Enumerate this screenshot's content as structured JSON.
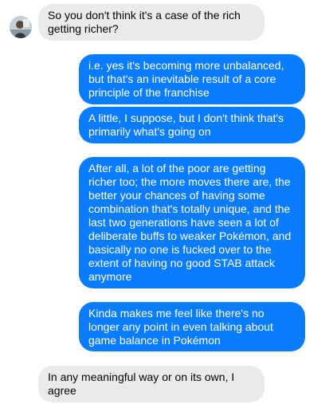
{
  "colors": {
    "incoming_bg": "#eaeaea",
    "incoming_text": "#050505",
    "outgoing_bg": "#0a7cff",
    "outgoing_text": "#ffffff"
  },
  "contact": {
    "avatar_icon": "profile-photo"
  },
  "messages": [
    {
      "from": "them",
      "text": "So you don't think it's a case of the rich getting richer?"
    },
    {
      "from": "me",
      "text": "i.e. yes it's becoming more unbalanced, but that's an inevitable result of a core principle of the franchise"
    },
    {
      "from": "me",
      "text": "A little, I suppose, but I don't think that's primarily what's going on"
    },
    {
      "from": "me",
      "text": "After all, a lot of the poor are getting richer too; the more moves there are, the better your chances of having some combination that's totally unique, and the last two generations have seen a lot of deliberate buffs to weaker Pokémon, and basically no one is fucked over to the extent of having no good STAB attack anymore"
    },
    {
      "from": "me",
      "text": "Kinda makes me feel like there's no longer any point in even talking about game balance in Pokémon"
    },
    {
      "from": "them",
      "text": "In any meaningful way or on its own, I agree"
    }
  ]
}
